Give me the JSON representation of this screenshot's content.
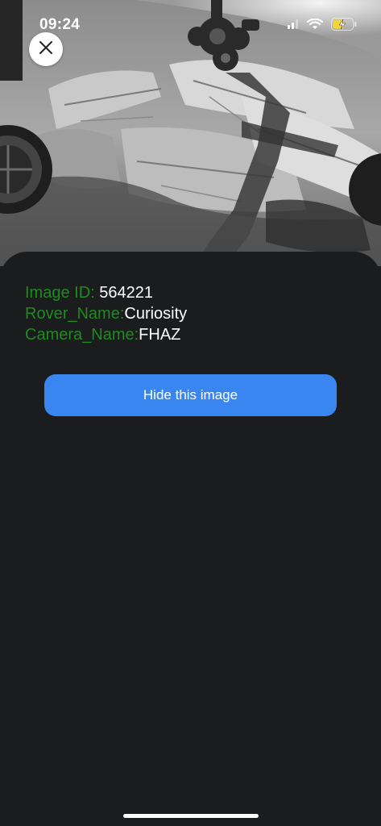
{
  "status_bar": {
    "time": "09:24",
    "icons": [
      "signal-icon",
      "wifi-icon",
      "battery-charging-icon"
    ],
    "battery_color": "#f5d43a"
  },
  "photo": {
    "description_icon": "rover-camera-image"
  },
  "close_button": {
    "icon": "close-icon"
  },
  "info": {
    "image_id_label": "Image ID: ",
    "image_id_value": "564221",
    "rover_label": "Rover_Name:",
    "rover_value": "Curiosity",
    "camera_label": "Camera_Name:",
    "camera_value": "FHAZ"
  },
  "hide_button": {
    "label": "Hide this image"
  },
  "colors": {
    "background": "#1b1c1e",
    "label_green": "#1f8a1f",
    "button_blue": "#3a86f0"
  }
}
